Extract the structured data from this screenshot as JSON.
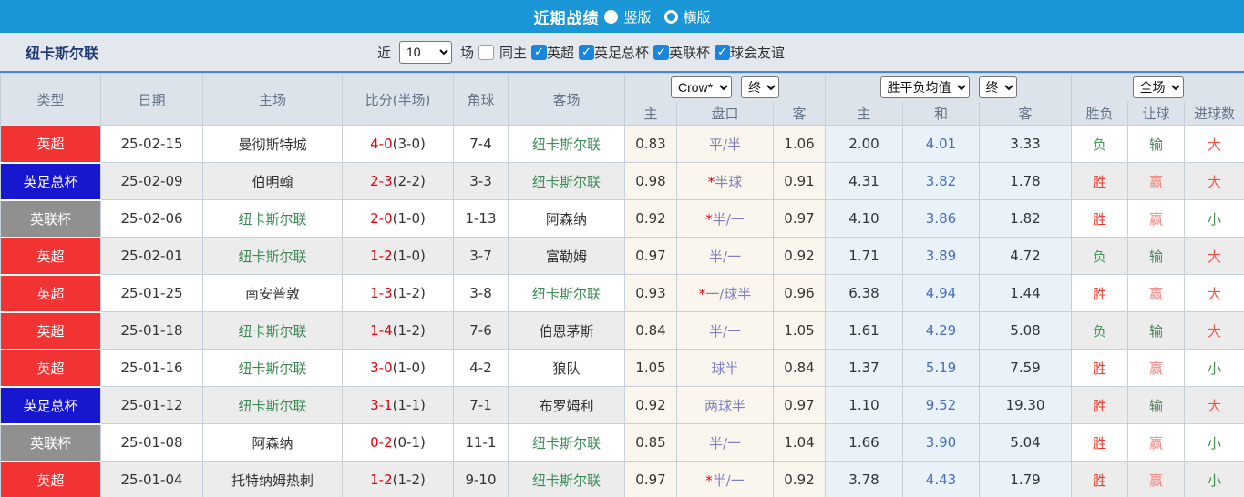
{
  "topbar": {
    "title": "近期战绩",
    "radios": [
      {
        "label": "竖版",
        "selected": true
      },
      {
        "label": "横版",
        "selected": false
      }
    ]
  },
  "filterbar": {
    "team": "纽卡斯尔联",
    "near_label": "近",
    "near_value": "10",
    "games_label": "场",
    "same_home": {
      "label": "同主",
      "checked": false
    },
    "competitions": [
      {
        "label": "英超",
        "checked": true
      },
      {
        "label": "英足总杯",
        "checked": true
      },
      {
        "label": "英联杯",
        "checked": true
      },
      {
        "label": "球会友谊",
        "checked": true
      }
    ]
  },
  "table": {
    "selects": {
      "company": "Crow*",
      "handicap_time": "终",
      "euro_type": "胜平负均值",
      "euro_time": "终",
      "scope": "全场"
    },
    "left_headers": [
      "类型",
      "日期",
      "主场",
      "比分(半场)",
      "角球",
      "客场"
    ],
    "sub_headers": [
      "主",
      "盘口",
      "客",
      "主",
      "和",
      "客",
      "胜负",
      "让球",
      "进球数"
    ],
    "rows": [
      {
        "type": "英超",
        "date": "25-02-15",
        "home": "曼彻斯特城",
        "ft": "4-0",
        "ht": "(3-0)",
        "corners": "7-4",
        "away": "纽卡斯尔联",
        "ah_home": "0.83",
        "ah_star": false,
        "ah_line": "平/半",
        "ah_away": "1.06",
        "eu_home": "2.00",
        "eu_draw": "4.01",
        "eu_away": "3.33",
        "result": "负",
        "handicap": "输",
        "goals": "大"
      },
      {
        "type": "英足总杯",
        "date": "25-02-09",
        "home": "伯明翰",
        "ft": "2-3",
        "ht": "(2-2)",
        "corners": "3-3",
        "away": "纽卡斯尔联",
        "ah_home": "0.98",
        "ah_star": true,
        "ah_line": "半球",
        "ah_away": "0.91",
        "eu_home": "4.31",
        "eu_draw": "3.82",
        "eu_away": "1.78",
        "result": "胜",
        "handicap": "赢",
        "goals": "大"
      },
      {
        "type": "英联杯",
        "date": "25-02-06",
        "home": "纽卡斯尔联",
        "ft": "2-0",
        "ht": "(1-0)",
        "corners": "1-13",
        "away": "阿森纳",
        "ah_home": "0.92",
        "ah_star": true,
        "ah_line": "半/一",
        "ah_away": "0.97",
        "eu_home": "4.10",
        "eu_draw": "3.86",
        "eu_away": "1.82",
        "result": "胜",
        "handicap": "赢",
        "goals": "小"
      },
      {
        "type": "英超",
        "date": "25-02-01",
        "home": "纽卡斯尔联",
        "ft": "1-2",
        "ht": "(1-0)",
        "corners": "3-7",
        "away": "富勒姆",
        "ah_home": "0.97",
        "ah_star": false,
        "ah_line": "半/一",
        "ah_away": "0.92",
        "eu_home": "1.71",
        "eu_draw": "3.89",
        "eu_away": "4.72",
        "result": "负",
        "handicap": "输",
        "goals": "大"
      },
      {
        "type": "英超",
        "date": "25-01-25",
        "home": "南安普敦",
        "ft": "1-3",
        "ht": "(1-2)",
        "corners": "3-8",
        "away": "纽卡斯尔联",
        "ah_home": "0.93",
        "ah_star": true,
        "ah_line": "一/球半",
        "ah_away": "0.96",
        "eu_home": "6.38",
        "eu_draw": "4.94",
        "eu_away": "1.44",
        "result": "胜",
        "handicap": "赢",
        "goals": "大"
      },
      {
        "type": "英超",
        "date": "25-01-18",
        "home": "纽卡斯尔联",
        "ft": "1-4",
        "ht": "(1-2)",
        "corners": "7-6",
        "away": "伯恩茅斯",
        "ah_home": "0.84",
        "ah_star": false,
        "ah_line": "半/一",
        "ah_away": "1.05",
        "eu_home": "1.61",
        "eu_draw": "4.29",
        "eu_away": "5.08",
        "result": "负",
        "handicap": "输",
        "goals": "大"
      },
      {
        "type": "英超",
        "date": "25-01-16",
        "home": "纽卡斯尔联",
        "ft": "3-0",
        "ht": "(1-0)",
        "corners": "4-2",
        "away": "狼队",
        "ah_home": "1.05",
        "ah_star": false,
        "ah_line": "球半",
        "ah_away": "0.84",
        "eu_home": "1.37",
        "eu_draw": "5.19",
        "eu_away": "7.59",
        "result": "胜",
        "handicap": "赢",
        "goals": "小"
      },
      {
        "type": "英足总杯",
        "date": "25-01-12",
        "home": "纽卡斯尔联",
        "ft": "3-1",
        "ht": "(1-1)",
        "corners": "7-1",
        "away": "布罗姆利",
        "ah_home": "0.92",
        "ah_star": false,
        "ah_line": "两球半",
        "ah_away": "0.97",
        "eu_home": "1.10",
        "eu_draw": "9.52",
        "eu_away": "19.30",
        "result": "胜",
        "handicap": "输",
        "goals": "大"
      },
      {
        "type": "英联杯",
        "date": "25-01-08",
        "home": "阿森纳",
        "ft": "0-2",
        "ht": "(0-1)",
        "corners": "11-1",
        "away": "纽卡斯尔联",
        "ah_home": "0.85",
        "ah_star": false,
        "ah_line": "半/一",
        "ah_away": "1.04",
        "eu_home": "1.66",
        "eu_draw": "3.90",
        "eu_away": "5.04",
        "result": "胜",
        "handicap": "赢",
        "goals": "小"
      },
      {
        "type": "英超",
        "date": "25-01-04",
        "home": "托特纳姆热刺",
        "ft": "1-2",
        "ht": "(1-2)",
        "corners": "9-10",
        "away": "纽卡斯尔联",
        "ah_home": "0.97",
        "ah_star": true,
        "ah_line": "半/一",
        "ah_away": "0.92",
        "eu_home": "3.78",
        "eu_draw": "4.43",
        "eu_away": "1.79",
        "result": "胜",
        "handicap": "赢",
        "goals": "小"
      }
    ]
  },
  "colors": {
    "topbar_bg": "#1b96d6",
    "type": {
      "英超": "#f23333",
      "英足总杯": "#1717cf",
      "英联杯": "#909090"
    },
    "result": {
      "胜": "#ee3b2b",
      "负": "#42a05c"
    },
    "handicap": {
      "赢": "#f2837d",
      "输": "#4d7f5b"
    },
    "goals": {
      "大": "#f4564c",
      "小": "#3f9048"
    },
    "self_team": "#3d8a57",
    "score_ft": "#e60012",
    "draw_odds": "#4a6db8",
    "handicap_line": "#8080c0"
  }
}
